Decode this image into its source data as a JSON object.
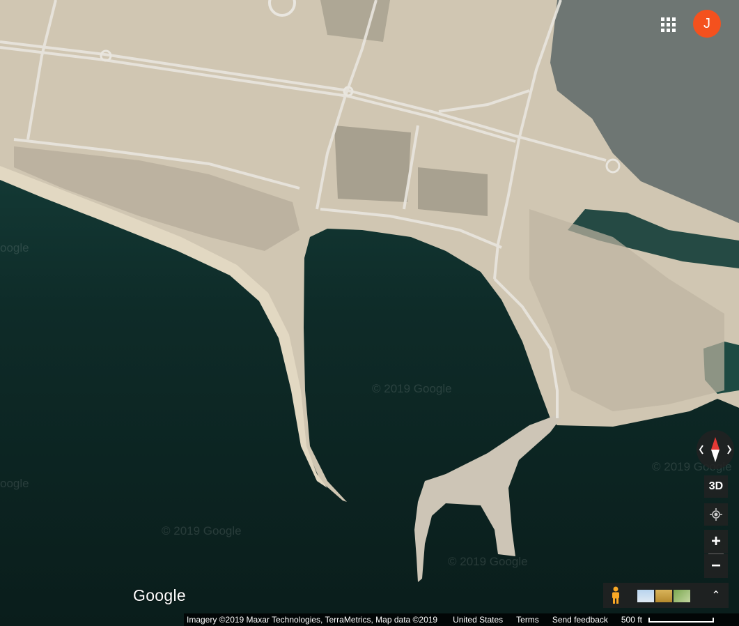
{
  "account": {
    "initial": "J"
  },
  "watermarks": [
    "© 2019 Google",
    "© 2019 Google",
    "© 2019 Google",
    "© 2019 Google",
    "oogle",
    "oogle"
  ],
  "controls": {
    "three_d_label": "3D",
    "zoom_in_label": "+",
    "zoom_out_label": "−",
    "expand_label": "⌃"
  },
  "logo": "Google",
  "footer": {
    "attribution": "Imagery ©2019 Maxar Technologies, TerraMetrics, Map data ©2019",
    "country": "United States",
    "terms": "Terms",
    "feedback": "Send feedback",
    "scale_label": "500 ft"
  },
  "icons": {
    "apps": "apps-grid-icon",
    "compass": "compass-icon",
    "location": "my-location-icon",
    "pegman": "pegman-icon",
    "layers": "imagery-layer-icons"
  },
  "colors": {
    "avatar": "#f4511e",
    "sea": "#0e2a27",
    "land": "#d2c7b3",
    "controls": "#222222"
  }
}
